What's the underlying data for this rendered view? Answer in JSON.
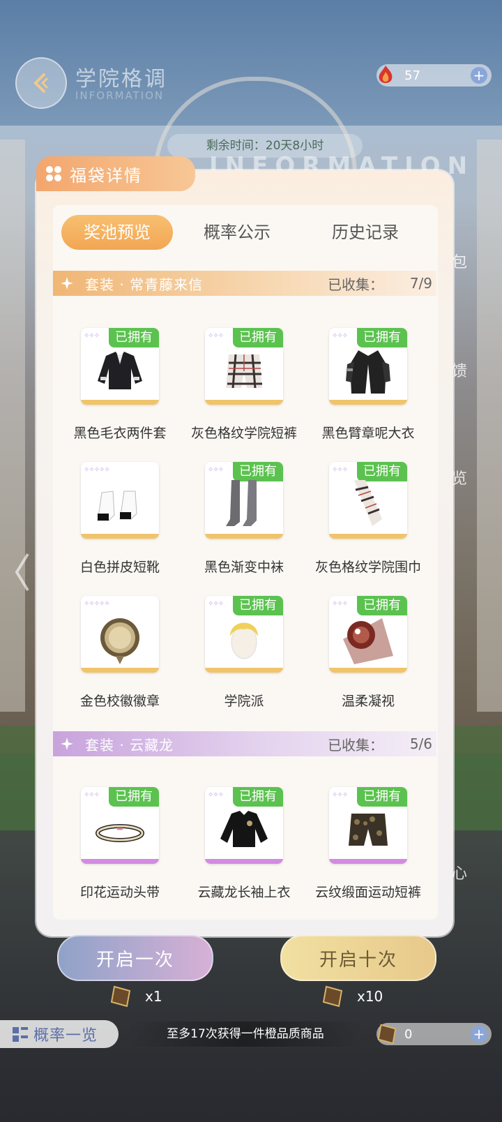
{
  "header": {
    "title": "学院格调",
    "subtitle": "INFORMATION",
    "currency_value": "57",
    "timer": "剩余时间：20天8小时",
    "bg_watermark": "INFORMATION"
  },
  "side_tabs": [
    "包",
    "馈",
    "览",
    "心"
  ],
  "modal": {
    "title": "福袋详情",
    "tabs": [
      {
        "label": "奖池预览",
        "active": true
      },
      {
        "label": "概率公示",
        "active": false
      },
      {
        "label": "历史记录",
        "active": false
      }
    ],
    "sections": [
      {
        "title": "套装 · 常青藤来信",
        "collected_label": "已收集：",
        "collected_count": "7/9",
        "color": "#f0b675",
        "items": [
          {
            "name": "黑色毛衣两件套",
            "owned": "已拥有",
            "stars": "✧✧✧"
          },
          {
            "name": "灰色格纹学院短裤",
            "owned": "已拥有",
            "stars": "✧✧✧"
          },
          {
            "name": "黑色臂章呢大衣",
            "owned": "已拥有",
            "stars": "✧✧✧"
          },
          {
            "name": "白色拼皮短靴",
            "owned": "",
            "stars": "✧✧✧✧✧"
          },
          {
            "name": "黑色渐变中袜",
            "owned": "已拥有",
            "stars": "✧✧✧"
          },
          {
            "name": "灰色格纹学院围巾",
            "owned": "已拥有",
            "stars": "✧✧✧"
          },
          {
            "name": "金色校徽徽章",
            "owned": "",
            "stars": "✧✧✧✧✧"
          },
          {
            "name": "学院派",
            "owned": "已拥有",
            "stars": "✧✧✧"
          },
          {
            "name": "温柔凝视",
            "owned": "已拥有",
            "stars": "✧✧✧"
          }
        ]
      },
      {
        "title": "套装 · 云藏龙",
        "collected_label": "已收集：",
        "collected_count": "5/6",
        "color": "#c8a3dc",
        "items": [
          {
            "name": "印花运动头带",
            "owned": "已拥有",
            "stars": "✧✧✧"
          },
          {
            "name": "云藏龙长袖上衣",
            "owned": "已拥有",
            "stars": "✧✧✧"
          },
          {
            "name": "云纹缎面运动短裤",
            "owned": "已拥有",
            "stars": "✧✧✧"
          }
        ]
      }
    ]
  },
  "actions": {
    "open_once": "开启一次",
    "open_ten": "开启十次",
    "once_cost": "x1",
    "ten_cost": "x10",
    "probability_list": "概率一览",
    "pity_note": "至多17次获得一件橙品质商品",
    "ticket_count": "0"
  }
}
